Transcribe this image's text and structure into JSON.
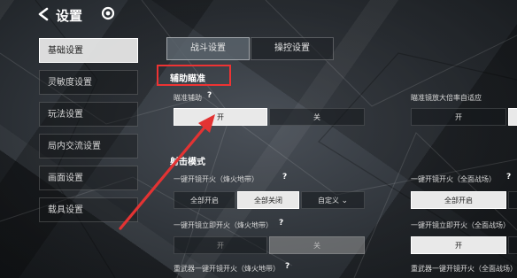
{
  "header": {
    "title": "设置",
    "back_icon": "chevron-left-icon",
    "logo_icon": "ring-logo-icon"
  },
  "sidebar": {
    "items": [
      {
        "label": "基础设置",
        "active": true
      },
      {
        "label": "灵敏度设置",
        "active": false
      },
      {
        "label": "玩法设置",
        "active": false
      },
      {
        "label": "局内交流设置",
        "active": false
      },
      {
        "label": "画面设置",
        "active": false
      },
      {
        "label": "载具设置",
        "active": false
      }
    ]
  },
  "tabs": [
    {
      "label": "战斗设置",
      "active": true
    },
    {
      "label": "操控设置",
      "active": false
    }
  ],
  "sections": {
    "aim_assist": {
      "title": "辅助瞄准",
      "aim_assist_label": "瞄准辅助",
      "aim_assist_help": "?",
      "aim_assist_options": [
        "开",
        "关"
      ],
      "scope_label": "瞄准镜放大倍率自适应",
      "scope_options": [
        "开"
      ]
    },
    "fire_mode": {
      "title": "射击模式",
      "one_key_scope_label": "一键开镜开火（烽火地带）",
      "one_key_scope_help": "?",
      "one_key_scope_options": [
        "全部开启",
        "全部关闭",
        "自定义"
      ],
      "one_key_scope_right_label": "一键开镜开火（全面战场）",
      "one_key_scope_right_help": "?",
      "one_key_scope_right_options": [
        "全部开启"
      ],
      "instant_fire_label": "一键开镜立即开火（烽火地带）",
      "instant_fire_help": "?",
      "instant_fire_options": [
        "开",
        "关"
      ],
      "instant_fire_right_label": "一键开镜立即开火（全面战场）",
      "instant_fire_right_options": [
        "开"
      ],
      "heavy_label": "重武器一键开镜开火（烽火地带）",
      "heavy_help": "?",
      "heavy_right_label": "重武器一键开镜开火（全面战场）"
    }
  },
  "colors": {
    "highlight": "#e33333",
    "arrow": "#e33333"
  }
}
